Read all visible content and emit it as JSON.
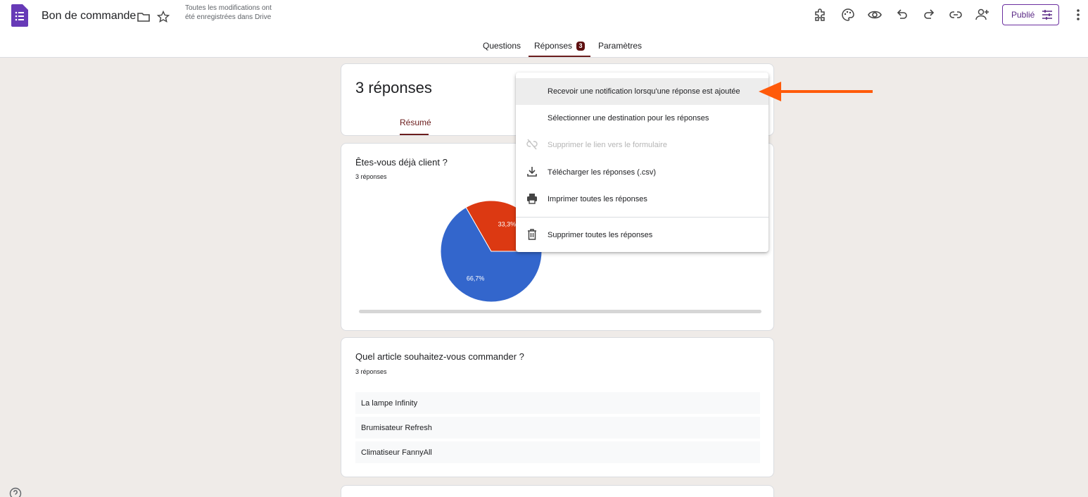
{
  "header": {
    "title": "Bon de commande",
    "save_status": "Toutes les modifications ont été enregistrées dans Drive",
    "publish_label": "Publié",
    "icons": [
      "forms-logo-icon",
      "folder-icon",
      "star-icon",
      "addon-icon",
      "palette-icon",
      "preview-eye-icon",
      "undo-icon",
      "redo-icon",
      "link-icon",
      "add-collaborator-icon",
      "publish-settings-icon",
      "more-vert-icon"
    ]
  },
  "tabs": {
    "questions": "Questions",
    "responses": "Réponses",
    "responses_badge": "3",
    "settings": "Paramètres",
    "active": "Réponses"
  },
  "summary": {
    "count_title": "3 réponses",
    "tab_label": "Résumé"
  },
  "questions": [
    {
      "title": "Êtes-vous déjà client ?",
      "sub": "3 réponses",
      "chart_data": {
        "type": "pie",
        "slices": [
          {
            "label": "66,7%",
            "value": 66.7,
            "color": "#3366cc"
          },
          {
            "label": "33,3%",
            "value": 33.3,
            "color": "#dc3912"
          }
        ]
      }
    },
    {
      "title": "Quel article souhaitez-vous commander ?",
      "sub": "3 réponses",
      "answers": [
        "La lampe Infinity",
        "Brumisateur Refresh",
        "Climatiseur FannyAll"
      ]
    }
  ],
  "menu": {
    "items": [
      {
        "label": "Recevoir une notification lorsqu'une réponse est ajoutée",
        "state": "highlighted"
      },
      {
        "label": "Sélectionner une destination pour les réponses",
        "state": "normal"
      },
      {
        "label": "Supprimer le lien vers le formulaire",
        "state": "disabled",
        "icon": "unlink-icon"
      },
      {
        "label": "Télécharger les réponses (.csv)",
        "state": "normal",
        "icon": "download-icon"
      },
      {
        "label": "Imprimer toutes les réponses",
        "state": "normal",
        "icon": "print-icon"
      },
      {
        "label": "Supprimer toutes les réponses",
        "state": "normal",
        "icon": "trash-icon"
      }
    ]
  },
  "colors": {
    "accent": "#6b1d1d",
    "forms_purple": "#673ab7",
    "pie_blue": "#3366cc",
    "pie_red": "#dc3912",
    "arrow_orange": "#ff5a0a"
  }
}
